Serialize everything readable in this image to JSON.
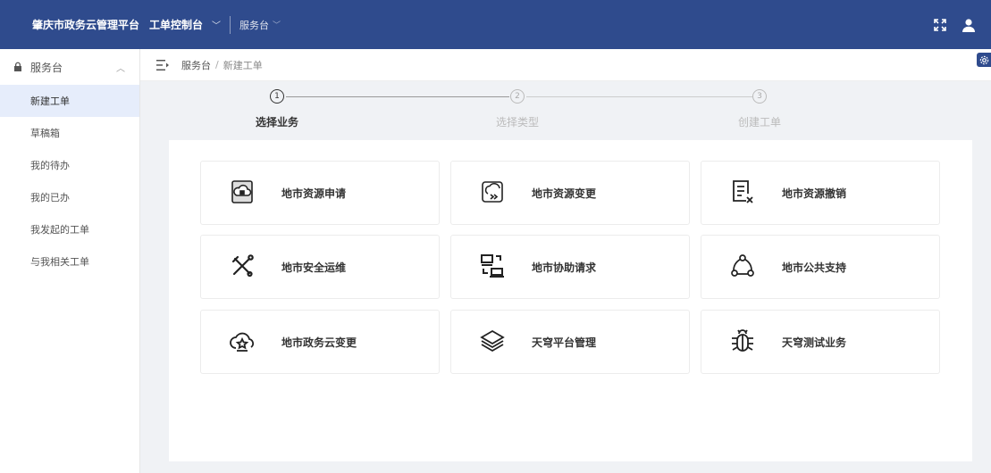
{
  "header": {
    "brand": "肇庆市政务云管理平台",
    "primary_nav": "工单控制台",
    "secondary_nav": "服务台"
  },
  "sidebar": {
    "group_label": "服务台",
    "items": [
      {
        "label": "新建工单",
        "active": true
      },
      {
        "label": "草稿箱"
      },
      {
        "label": "我的待办"
      },
      {
        "label": "我的已办"
      },
      {
        "label": "我发起的工单"
      },
      {
        "label": "与我相关工单"
      }
    ]
  },
  "breadcrumb": {
    "root": "服务台",
    "separator": "/",
    "current": "新建工单"
  },
  "steps": [
    {
      "number": "1",
      "label": "选择业务",
      "active": true
    },
    {
      "number": "2",
      "label": "选择类型"
    },
    {
      "number": "3",
      "label": "创建工单"
    }
  ],
  "services": [
    {
      "label": "地市资源申请",
      "icon": "cloud-lock-icon"
    },
    {
      "label": "地市资源变更",
      "icon": "cloud-change-icon"
    },
    {
      "label": "地市资源撤销",
      "icon": "document-cancel-icon"
    },
    {
      "label": "地市安全运维",
      "icon": "tools-icon"
    },
    {
      "label": "地市协助请求",
      "icon": "devices-icon"
    },
    {
      "label": "地市公共支持",
      "icon": "network-icon"
    },
    {
      "label": "地市政务云变更",
      "icon": "cloud-star-icon"
    },
    {
      "label": "天穹平台管理",
      "icon": "layers-icon"
    },
    {
      "label": "天穹测试业务",
      "icon": "bug-icon"
    }
  ],
  "colors": {
    "header_bg": "#2f4b8d",
    "active_item_bg": "#e6edfb",
    "page_bg": "#f0f2f5"
  }
}
